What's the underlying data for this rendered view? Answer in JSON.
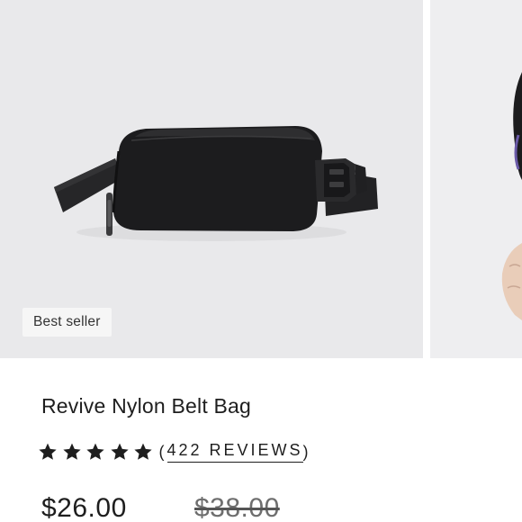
{
  "product": {
    "badge": "Best seller",
    "title": "Revive Nylon Belt Bag",
    "rating": {
      "stars_filled": 5,
      "stars_total": 5,
      "reviews_open": "(",
      "reviews_text": "422 REVIEWS",
      "reviews_close": ")"
    },
    "price": {
      "sale": "$26.00",
      "original": "$38.00"
    }
  },
  "colors": {
    "image_background": "#e9e9eb",
    "bag": "#1c1c1e",
    "text": "#1e1e1e",
    "muted_text": "#6e6e6e"
  },
  "icons": {
    "star": "star-filled-icon"
  }
}
